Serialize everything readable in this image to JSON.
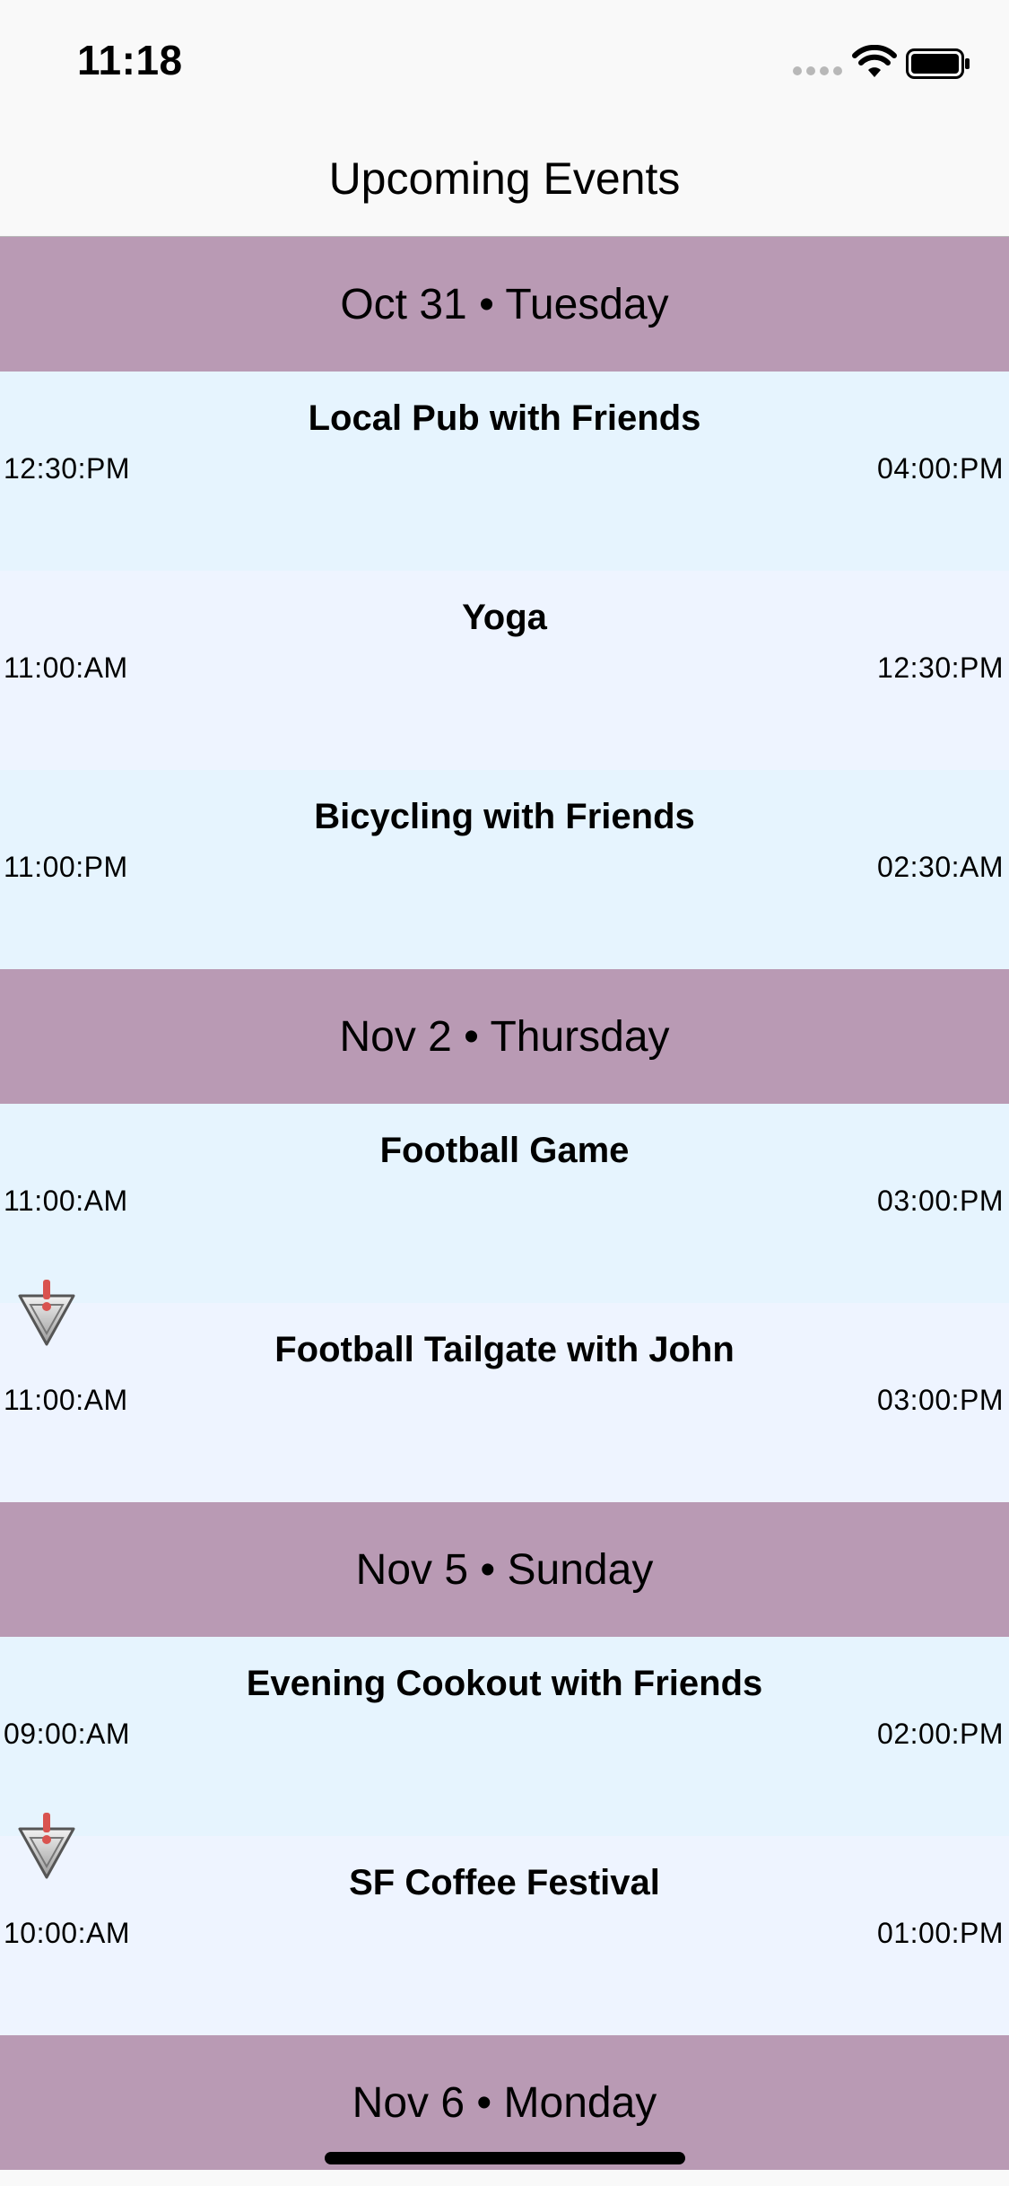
{
  "status_bar": {
    "time": "11:18",
    "icons": [
      "signal-icon",
      "wifi-icon",
      "battery-icon"
    ]
  },
  "nav": {
    "title": "Upcoming Events"
  },
  "colors": {
    "section_header": "#b99ab4",
    "row_light_blue": "#e6f4fe",
    "row_lavender": "#eef4ff"
  },
  "sections": [
    {
      "header": "Oct 31 • Tuesday",
      "events": [
        {
          "title": "Local Pub with Friends",
          "start": "12:30:PM",
          "end": "04:00:PM",
          "alert": false
        },
        {
          "title": "Yoga",
          "start": "11:00:AM",
          "end": "12:30:PM",
          "alert": false
        },
        {
          "title": "Bicycling with Friends",
          "start": "11:00:PM",
          "end": "02:30:AM",
          "alert": false
        }
      ]
    },
    {
      "header": "Nov 2 • Thursday",
      "events": [
        {
          "title": "Football Game",
          "start": "11:00:AM",
          "end": "03:00:PM",
          "alert": false
        },
        {
          "title": "Football Tailgate with John",
          "start": "11:00:AM",
          "end": "03:00:PM",
          "alert": true
        }
      ]
    },
    {
      "header": "Nov 5 • Sunday",
      "events": [
        {
          "title": "Evening Cookout with Friends",
          "start": "09:00:AM",
          "end": "02:00:PM",
          "alert": false
        },
        {
          "title": "SF Coffee Festival",
          "start": "10:00:AM",
          "end": "01:00:PM",
          "alert": true
        }
      ]
    },
    {
      "header": "Nov 6 • Monday",
      "events": []
    }
  ]
}
